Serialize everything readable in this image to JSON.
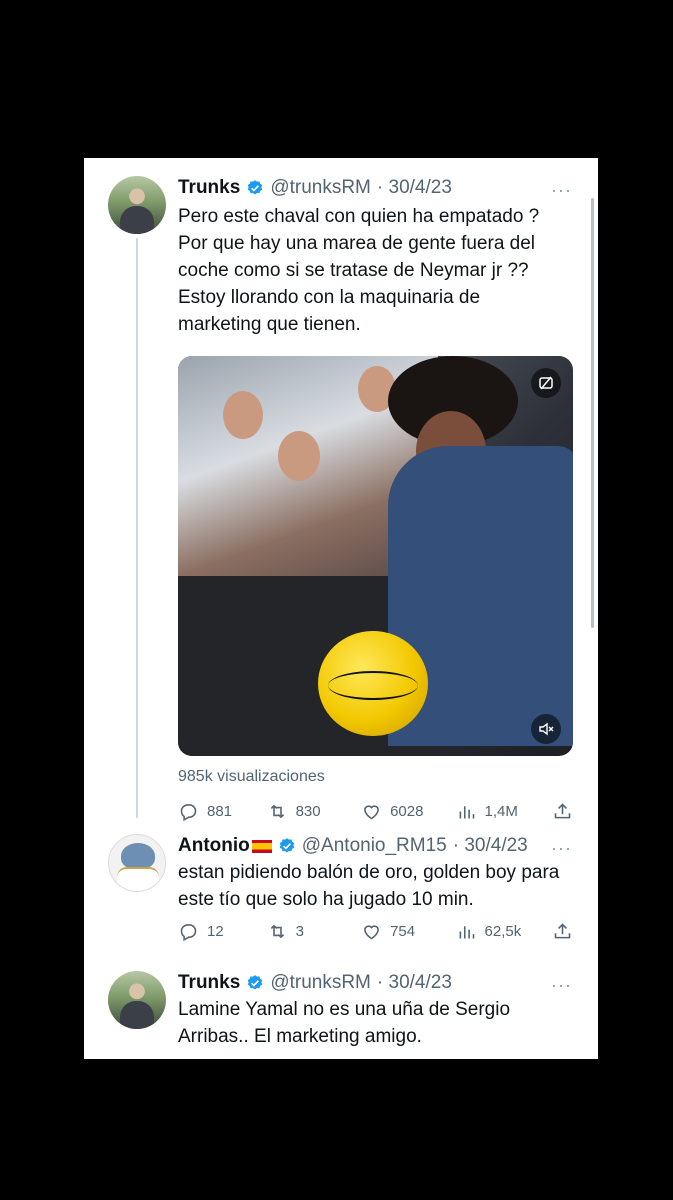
{
  "tweets": [
    {
      "name": "Trunks",
      "handle": "@trunksRM",
      "date": "· 30/4/23",
      "text": "Pero este chaval con quien ha empatado ? Por que hay una marea de gente fuera del coche como si se tratase de Neymar jr ?? Estoy llorando con la maquinaria de marketing que tienen.",
      "views": "985k visualizaciones",
      "replies": "881",
      "retweets": "830",
      "likes": "6028",
      "impressions": "1,4M"
    },
    {
      "name": "Antonio",
      "handle": "@Antonio_RM15",
      "date": "· 30/4/23",
      "text": "estan pidiendo balón de oro, golden boy para este tío que solo ha jugado 10 min.",
      "replies": "12",
      "retweets": "3",
      "likes": "754",
      "impressions": "62,5k"
    },
    {
      "name": "Trunks",
      "handle": "@trunksRM",
      "date": "· 30/4/23",
      "text": "Lamine Yamal no es una uña de Sergio Arribas.. El marketing amigo."
    }
  ],
  "more_glyph": "···",
  "colors": {
    "verified": "#1d9bf0",
    "muted": "#536471",
    "thread_line": "#cfd9de"
  }
}
